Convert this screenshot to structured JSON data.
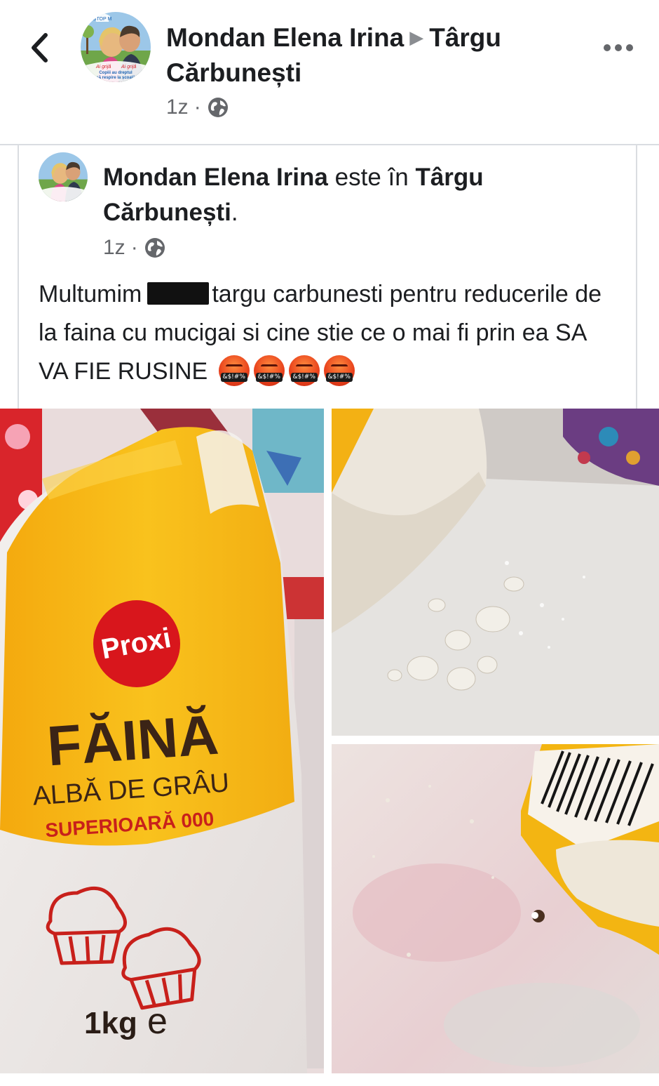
{
  "header": {
    "author": "Mondan Elena Irina",
    "location": "Târgu Cărbunești",
    "time": "1z",
    "icons": {
      "back": "chevron-left-icon",
      "more": "more-horizontal-icon",
      "audience": "globe-icon",
      "separator": "triangle-right-icon"
    }
  },
  "post": {
    "author": "Mondan Elena Irina",
    "connector": "este în",
    "location": "Târgu Cărbunești",
    "suffix": ".",
    "time": "1z",
    "text_part1": "Multumim",
    "text_part2": "targu carbunesti pentru reducerile de la faina cu mucigai si cine stie ce o mai fi prin ea SA VA FIE RUSINE",
    "emoji_label": "&$!#%",
    "emoji_count": 4
  },
  "photo1": {
    "brand": "Proxi",
    "product": "FĂINĂ",
    "subtitle": "ALBĂ DE GRÂU",
    "grade": "SUPERIOARĂ 000",
    "weight": "1kg",
    "weight_mark": "e"
  },
  "avatar": {
    "badge_top": "STOP M",
    "badge_left": "Ai grijă",
    "badge_right": "Ai grijă",
    "badge_line1": "Copiii au dreptul",
    "badge_line2": "să respire la școală"
  },
  "colors": {
    "text": "#1c1e21",
    "secondary": "#65676b",
    "divider": "#dadde1",
    "bag_yellow": "#f7b612",
    "proxi_red": "#d8161c",
    "text_red": "#c8201b"
  }
}
